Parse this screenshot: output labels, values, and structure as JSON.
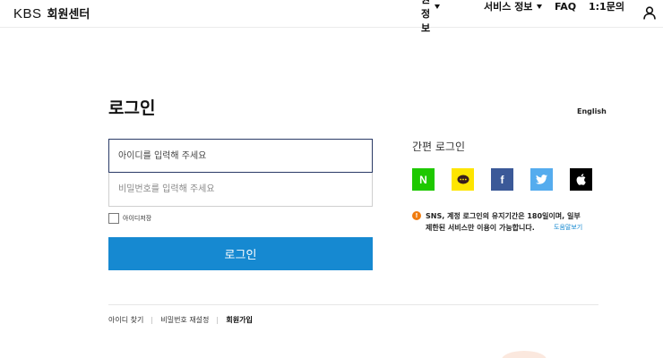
{
  "header": {
    "brand_kbs": "KBS",
    "brand_title": "회원센터",
    "nav": [
      {
        "label": "회원정보",
        "has_dropdown": true
      },
      {
        "label": "서비스 정보",
        "has_dropdown": true
      },
      {
        "label": "FAQ",
        "has_dropdown": false
      },
      {
        "label": "1:1문의",
        "has_dropdown": false
      }
    ],
    "user_icon": "user-icon"
  },
  "login": {
    "title": "로그인",
    "language_link": "English",
    "id_placeholder": "아이디를 입력해 주세요",
    "password_placeholder": "비밀번호를 입력해 주세요",
    "save_id_label": "아이디저장",
    "submit_label": "로그인"
  },
  "footer_links": [
    {
      "label": "아이디 찾기"
    },
    {
      "label": "비밀번호 재설정"
    },
    {
      "label": "회원가입"
    }
  ],
  "sns": {
    "title": "간편 로그인",
    "providers": [
      {
        "name": "naver",
        "glyph": "N",
        "color": "#1ec800"
      },
      {
        "name": "kakao",
        "color": "#fee500"
      },
      {
        "name": "facebook",
        "glyph": "f",
        "color": "#3b5998"
      },
      {
        "name": "twitter",
        "color": "#55acee"
      },
      {
        "name": "apple",
        "color": "#000000"
      }
    ],
    "notice_icon": "!",
    "notice_line1": "SNS, 계정 로그인의 유지기간은 180일이며, 일부",
    "notice_line2": "제한된 서비스만 이용이 가능합니다.",
    "help_link": "도움말보기"
  },
  "colors": {
    "accent": "#1689d1",
    "notice": "#f07c10"
  }
}
